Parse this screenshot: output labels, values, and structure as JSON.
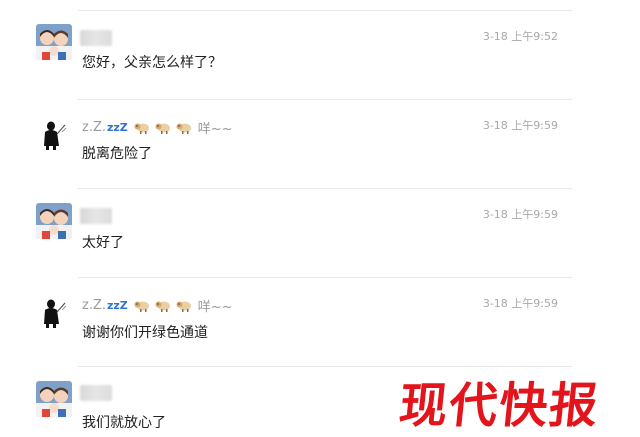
{
  "messages": [
    {
      "sender": "family",
      "time": "3-18 上午9:52",
      "text": "您好，父亲怎么样了？"
    },
    {
      "sender": "doctor",
      "nickname_prefix": "z.Z.",
      "nickname_zz": "zzZ",
      "nickname_suffix": "咩~~",
      "time": "3-18 上午9:59",
      "text": "脱离危险了"
    },
    {
      "sender": "family",
      "time": "3-18 上午9:59",
      "text": "太好了"
    },
    {
      "sender": "doctor",
      "nickname_prefix": "z.Z.",
      "nickname_zz": "zzZ",
      "nickname_suffix": "咩~~",
      "time": "3-18 上午9:59",
      "text": "谢谢你们开绿色通道"
    },
    {
      "sender": "family",
      "time": "",
      "text": "我们就放心了"
    }
  ],
  "watermark": "现代快报",
  "colors": {
    "watermark": "#e3141b",
    "zz": "#2f72d6",
    "divider": "#e8e8e8",
    "time": "#a8a8a8"
  }
}
